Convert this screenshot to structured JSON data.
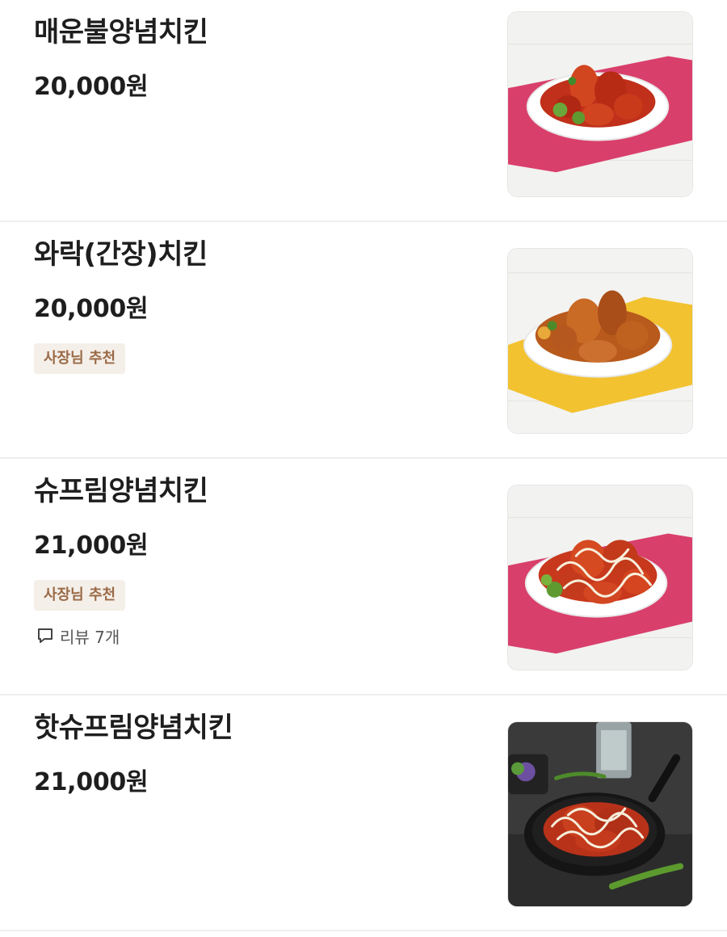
{
  "menu": {
    "items": [
      {
        "name": "매운불양념치킨",
        "price": "20,000원",
        "image_icon": "spicy-fire-chicken-photo"
      },
      {
        "name": "와락(간장)치킨",
        "price": "20,000원",
        "badge": "사장님 추천",
        "image_icon": "soy-sauce-chicken-photo"
      },
      {
        "name": "슈프림양념치킨",
        "price": "21,000원",
        "badge": "사장님 추천",
        "review_label": "리뷰 7개",
        "review_icon": "speech-bubble-icon",
        "image_icon": "supreme-chicken-photo"
      },
      {
        "name": "핫슈프림양념치킨",
        "price": "21,000원",
        "image_icon": "hot-supreme-chicken-photo"
      }
    ]
  },
  "colors": {
    "badge_text": "#9a6a46",
    "badge_bg": "#f4efe9",
    "divider": "#efefef"
  }
}
